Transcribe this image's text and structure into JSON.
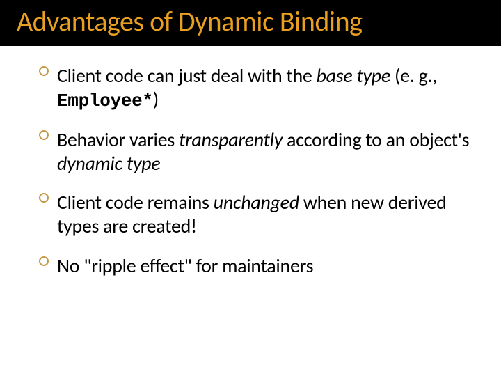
{
  "title": "Advantages of Dynamic Binding",
  "bullets": [
    {
      "pre": "Client code can just deal with the ",
      "em1": "base type",
      "mid": " (e. g., ",
      "code": "Employee*",
      "post": ")"
    },
    {
      "pre": "Behavior varies ",
      "em1": "transparently",
      "mid": " according to an object's ",
      "em2": "dynamic type",
      "post": ""
    },
    {
      "pre": "Client code remains ",
      "em1": "unchanged",
      "mid": " when new derived types are created!",
      "post": ""
    },
    {
      "pre": "No \"ripple effect\" for maintainers",
      "post": ""
    }
  ]
}
